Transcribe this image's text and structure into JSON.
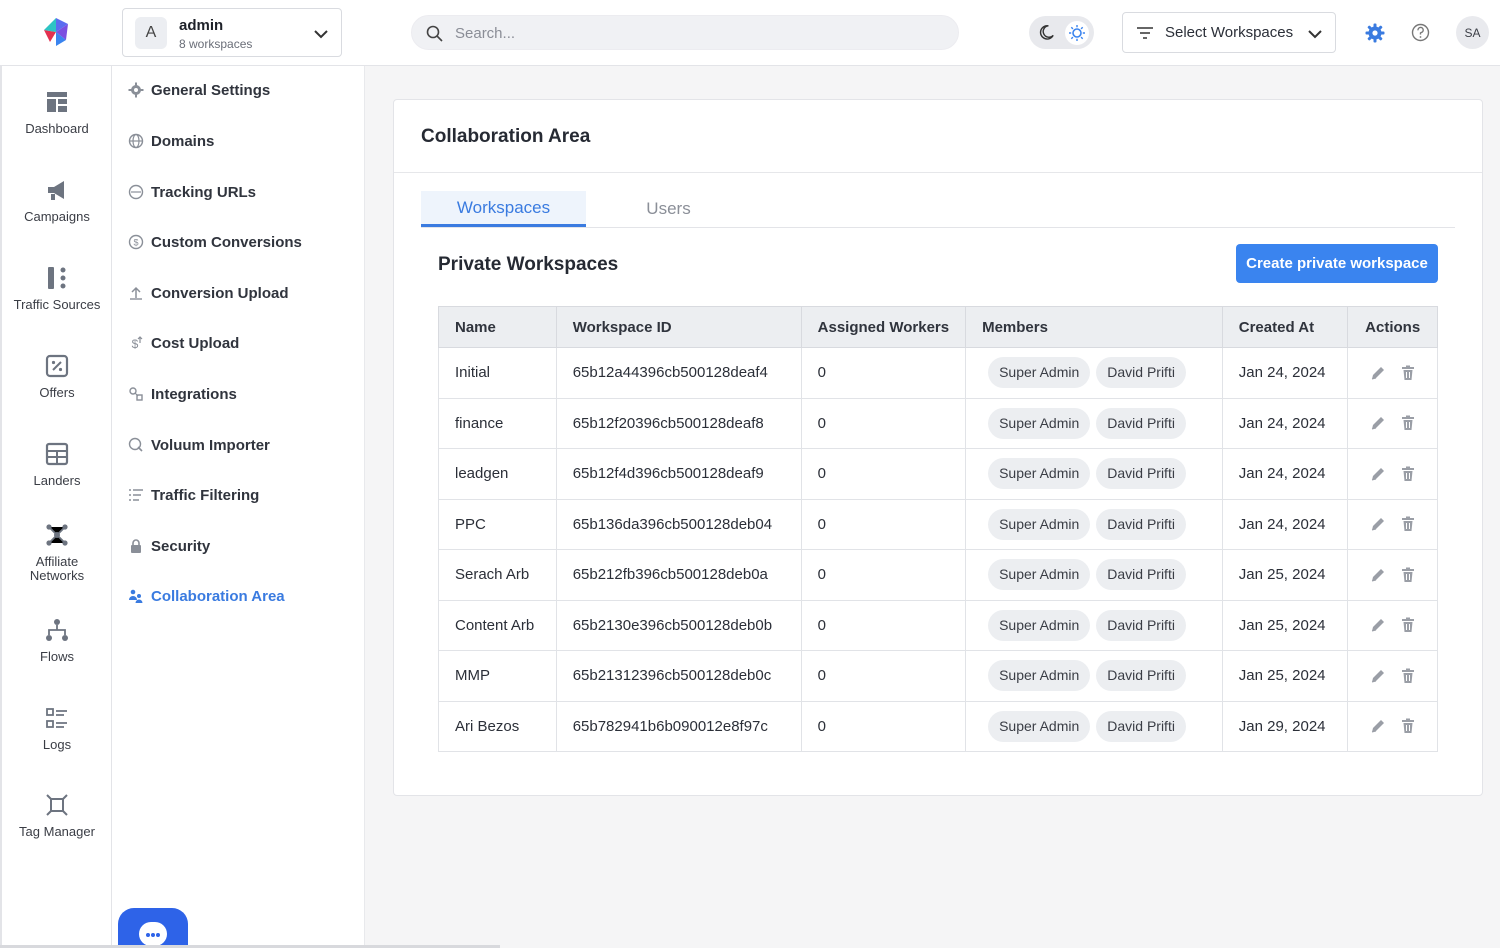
{
  "header": {
    "account": {
      "avatar_letter": "A",
      "name": "admin",
      "subtitle": "8 workspaces"
    },
    "search": {
      "placeholder": "Search..."
    },
    "workspace_select_label": "Select Workspaces",
    "user_initials": "SA",
    "accent_color": "#3a84ef"
  },
  "rail": {
    "items": [
      {
        "label": "Dashboard",
        "icon": "dashboard-icon"
      },
      {
        "label": "Campaigns",
        "icon": "megaphone-icon"
      },
      {
        "label": "Traffic Sources",
        "icon": "traffic-sources-icon"
      },
      {
        "label": "Offers",
        "icon": "offers-icon"
      },
      {
        "label": "Landers",
        "icon": "landers-icon"
      },
      {
        "label": "Affiliate Networks",
        "icon": "network-icon"
      },
      {
        "label": "Flows",
        "icon": "flows-icon"
      },
      {
        "label": "Logs",
        "icon": "logs-icon"
      },
      {
        "label": "Tag Manager",
        "icon": "tag-manager-icon"
      }
    ]
  },
  "settings_menu": {
    "items": [
      {
        "label": "General Settings",
        "icon": "gear-icon"
      },
      {
        "label": "Domains",
        "icon": "globe-icon"
      },
      {
        "label": "Tracking URLs",
        "icon": "www-icon"
      },
      {
        "label": "Custom Conversions",
        "icon": "dollar-circle-icon"
      },
      {
        "label": "Conversion Upload",
        "icon": "upload-icon"
      },
      {
        "label": "Cost Upload",
        "icon": "dollar-upload-icon"
      },
      {
        "label": "Integrations",
        "icon": "integrations-icon"
      },
      {
        "label": "Voluum Importer",
        "icon": "importer-icon"
      },
      {
        "label": "Traffic Filtering",
        "icon": "filter-list-icon"
      },
      {
        "label": "Security",
        "icon": "lock-icon"
      },
      {
        "label": "Collaboration Area",
        "icon": "users-icon",
        "active": true
      }
    ]
  },
  "main": {
    "title": "Collaboration Area",
    "tabs": [
      {
        "label": "Workspaces",
        "active": true
      },
      {
        "label": "Users",
        "active": false
      }
    ],
    "section_title": "Private Workspaces",
    "create_button": "Create private workspace",
    "table": {
      "columns": [
        "Name",
        "Workspace ID",
        "Assigned Workers",
        "Members",
        "Created At",
        "Actions"
      ],
      "rows": [
        {
          "name": "Initial",
          "id": "65b12a44396cb500128deaf4",
          "workers": "0",
          "members": [
            "Super Admin",
            "David Prifti"
          ],
          "created": "Jan 24, 2024"
        },
        {
          "name": "finance",
          "id": "65b12f20396cb500128deaf8",
          "workers": "0",
          "members": [
            "Super Admin",
            "David Prifti"
          ],
          "created": "Jan 24, 2024"
        },
        {
          "name": "leadgen",
          "id": "65b12f4d396cb500128deaf9",
          "workers": "0",
          "members": [
            "Super Admin",
            "David Prifti"
          ],
          "created": "Jan 24, 2024"
        },
        {
          "name": "PPC",
          "id": "65b136da396cb500128deb04",
          "workers": "0",
          "members": [
            "Super Admin",
            "David Prifti"
          ],
          "created": "Jan 24, 2024"
        },
        {
          "name": "Serach Arb",
          "id": "65b212fb396cb500128deb0a",
          "workers": "0",
          "members": [
            "Super Admin",
            "David Prifti"
          ],
          "created": "Jan 25, 2024"
        },
        {
          "name": "Content Arb",
          "id": "65b2130e396cb500128deb0b",
          "workers": "0",
          "members": [
            "Super Admin",
            "David Prifti"
          ],
          "created": "Jan 25, 2024"
        },
        {
          "name": "MMP",
          "id": "65b21312396cb500128deb0c",
          "workers": "0",
          "members": [
            "Super Admin",
            "David Prifti"
          ],
          "created": "Jan 25, 2024"
        },
        {
          "name": "Ari Bezos",
          "id": "65b782941b6b090012e8f97c",
          "workers": "0",
          "members": [
            "Super Admin",
            "David Prifti"
          ],
          "created": "Jan 29, 2024"
        }
      ]
    }
  }
}
